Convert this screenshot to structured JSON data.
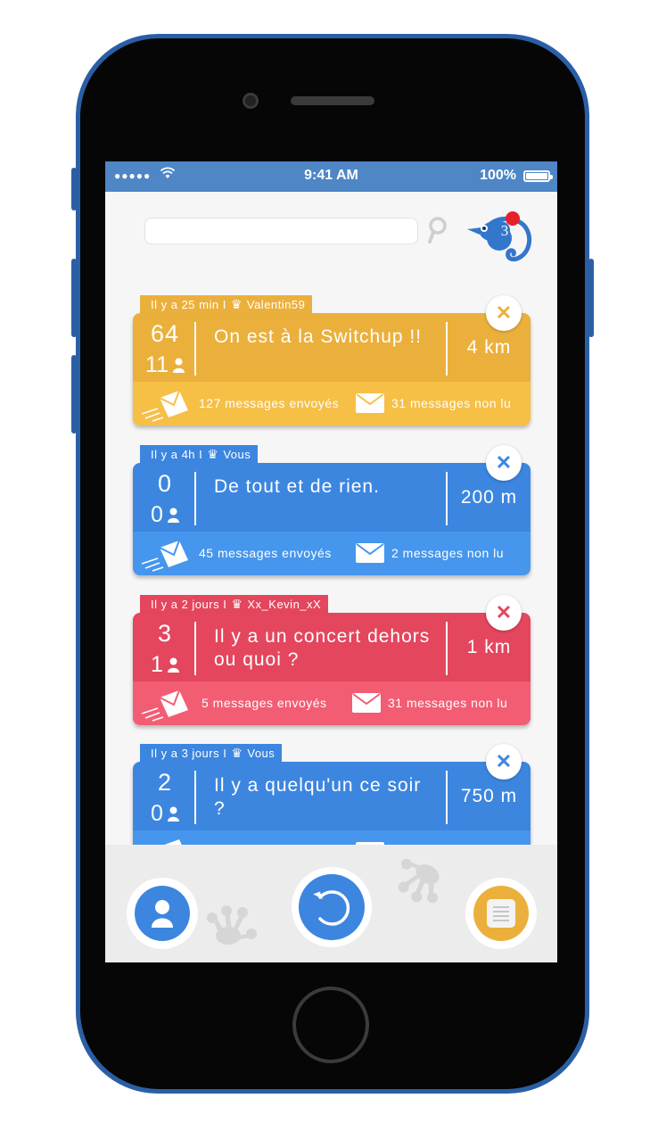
{
  "status_bar": {
    "signal": "●●●●●",
    "wifi": "wifi-icon",
    "time": "9:41 AM",
    "battery": "100%"
  },
  "search": {
    "value": "",
    "placeholder": "",
    "icon": "search-icon"
  },
  "notifications": {
    "count": "3",
    "mascot_icon": "chameleon-icon"
  },
  "colors": {
    "orange": "#ebb03c",
    "orange_bottom": "#f6bf46",
    "blue": "#3c86e0",
    "blue_bottom": "#4596ec",
    "red": "#e4465d",
    "red_bottom": "#f35d74",
    "status_bar": "#4e86c6"
  },
  "cards": [
    {
      "time": "Il y a 25 min I",
      "author": "Valentin59",
      "stat1": "64",
      "stat2": "11",
      "title": "On est à la Switchup !!",
      "distance": "4 km",
      "sent": "127 messages envoyés",
      "unread": "31 messages non lu",
      "close": "✕"
    },
    {
      "time": "Il y a 4h I",
      "author": "Vous",
      "stat1": "0",
      "stat2": "0",
      "title": "De tout et de rien.",
      "distance": "200 m",
      "sent": "45 messages envoyés",
      "unread": "2 messages non lu",
      "close": "✕"
    },
    {
      "time": "Il y a 2 jours I",
      "author": "Xx_Kevin_xX",
      "stat1": "3",
      "stat2": "1",
      "title": "Il y a un concert dehors ou quoi ?",
      "distance": "1 km",
      "sent": "5 messages envoyés",
      "unread": "31 messages non lu",
      "close": "✕"
    },
    {
      "time": "Il y a 3 jours I",
      "author": "Vous",
      "stat1": "2",
      "stat2": "0",
      "title": "Il y a quelqu'un ce soir ?",
      "distance": "750 m",
      "sent": "",
      "unread": "",
      "close": "✕"
    }
  ],
  "bottom_nav": {
    "profile_icon": "user-icon",
    "refresh_icon": "refresh-icon",
    "list_icon": "list-icon"
  }
}
